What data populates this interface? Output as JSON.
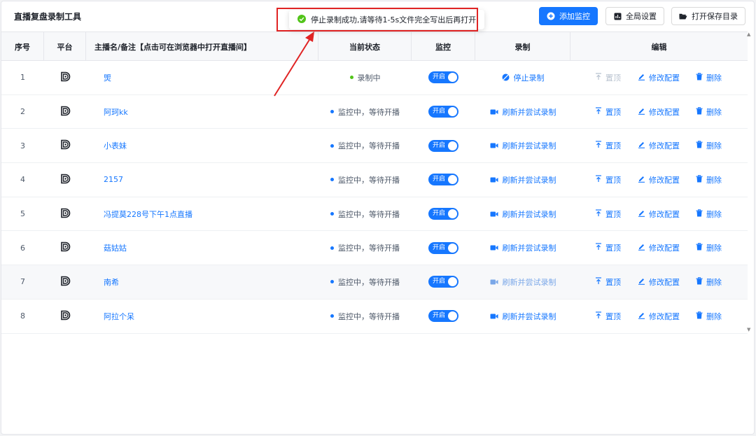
{
  "app": {
    "title": "直播复盘录制工具"
  },
  "toolbar": {
    "add_label": "添加监控",
    "settings_label": "全局设置",
    "open_dir_label": "打开保存目录"
  },
  "toast": {
    "message": "停止录制成功,请等待1-5s文件完全写出后再打开"
  },
  "columns": {
    "index": "序号",
    "platform": "平台",
    "name": "主播名/备注【点击可在浏览器中打开直播间】",
    "status": "当前状态",
    "monitor": "监控",
    "record": "录制",
    "edit": "编辑"
  },
  "switch_label": "开启",
  "actions": {
    "top": "置顶",
    "edit": "修改配置",
    "delete": "删除"
  },
  "rows": [
    {
      "index": "1",
      "name": "煚",
      "status": "录制中",
      "status_color": "#52c41a",
      "record": "停止录制",
      "record_icon": "stop-icon",
      "top_disabled": true
    },
    {
      "index": "2",
      "name": "阿珂kk",
      "status": "监控中，等待开播",
      "status_color": "#1677ff",
      "record": "刷新并尝试录制",
      "record_icon": "video-icon",
      "top_disabled": false
    },
    {
      "index": "3",
      "name": "小表妹",
      "status": "监控中，等待开播",
      "status_color": "#1677ff",
      "record": "刷新并尝试录制",
      "record_icon": "video-icon",
      "top_disabled": false
    },
    {
      "index": "4",
      "name": "2157",
      "status": "监控中，等待开播",
      "status_color": "#1677ff",
      "record": "刷新并尝试录制",
      "record_icon": "video-icon",
      "top_disabled": false
    },
    {
      "index": "5",
      "name": "冯提莫228号下午1点直播",
      "status": "监控中，等待开播",
      "status_color": "#1677ff",
      "record": "刷新并尝试录制",
      "record_icon": "video-icon",
      "top_disabled": false
    },
    {
      "index": "6",
      "name": "菇姑姑",
      "status": "监控中，等待开播",
      "status_color": "#1677ff",
      "record": "刷新并尝试录制",
      "record_icon": "video-icon",
      "top_disabled": false
    },
    {
      "index": "7",
      "name": "南希",
      "status": "监控中，等待开播",
      "status_color": "#1677ff",
      "record": "刷新并尝试录制",
      "record_icon": "video-icon",
      "top_disabled": false
    },
    {
      "index": "8",
      "name": "阿拉个呆",
      "status": "监控中，等待开播",
      "status_color": "#1677ff",
      "record": "刷新并尝试录制",
      "record_icon": "video-icon",
      "top_disabled": false
    }
  ],
  "colors": {
    "accent": "#1677ff",
    "success": "#52c41a",
    "highlight": "#e02424"
  }
}
